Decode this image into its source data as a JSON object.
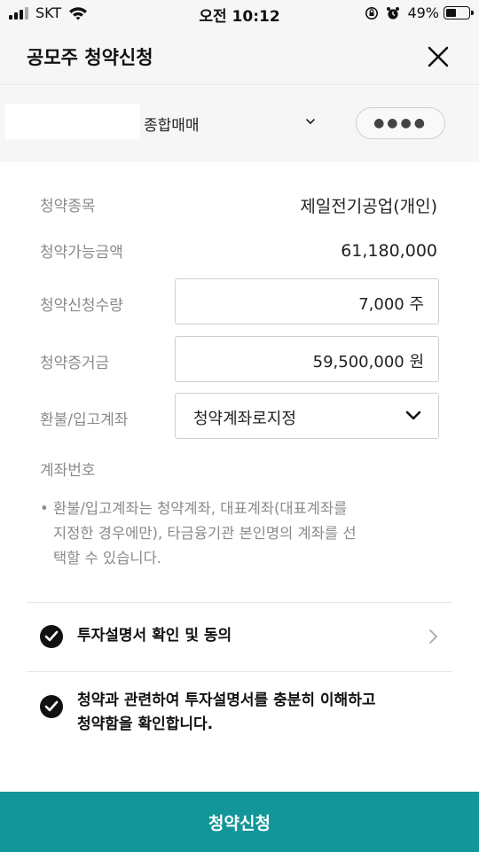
{
  "status_bar": {
    "carrier": "SKT",
    "time": "오전 10:12",
    "battery": "49%",
    "battery_level": 0.49
  },
  "header": {
    "title": "공모주 청약신청"
  },
  "account": {
    "type": "종합매매",
    "password_mask": "●●●●"
  },
  "form": {
    "stock_label": "청약종목",
    "stock_value": "제일전기공업(개인)",
    "available_label": "청약가능금액",
    "available_value": "61,180,000",
    "quantity_label": "청약신청수량",
    "quantity_value": "7,000 주",
    "deposit_label": "청약증거금",
    "deposit_value": "59,500,000 원",
    "refund_label": "환불/입고계좌",
    "refund_value": "청약계좌로지정",
    "account_no_label": "계좌번호"
  },
  "note": {
    "bullet": "•",
    "lines": [
      "환불/입고계좌는 청약계좌, 대표계좌(대표계좌를",
      "지정한 경우에만), 타금융기관 본인명의 계좌를 선",
      "택할 수 있습니다."
    ]
  },
  "agreements": {
    "prospectus": "투자설명서 확인 및 동의",
    "confirm_line1": "청약과 관련하여 투자설명서를 충분히 이해하고",
    "confirm_line2": "청약함을 확인합니다."
  },
  "submit": {
    "label": "청약신청"
  },
  "colors": {
    "accent": "#12969a",
    "label_gray": "#8a8a8a"
  }
}
